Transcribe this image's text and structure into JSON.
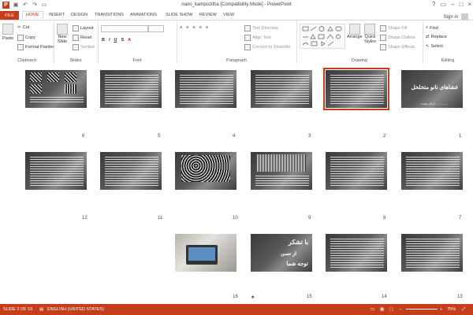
{
  "window": {
    "title": "nano_kampozitha [Compatibility Mode] - PowerPoint",
    "signin": "Sign in"
  },
  "tabs": [
    "FILE",
    "HOME",
    "INSERT",
    "DESIGN",
    "TRANSITIONS",
    "ANIMATIONS",
    "SLIDE SHOW",
    "REVIEW",
    "VIEW"
  ],
  "active_tab": "HOME",
  "ribbon": {
    "clipboard": {
      "label": "Clipboard",
      "paste": "Paste",
      "cut": "Cut",
      "copy": "Copy",
      "format_painter": "Format Painter"
    },
    "slides": {
      "label": "Slides",
      "new_slide": "New",
      "new_slide_2": "Slide",
      "layout": "Layout",
      "reset": "Reset",
      "section": "Section"
    },
    "font": {
      "label": "Font"
    },
    "paragraph": {
      "label": "Paragraph",
      "text_direction": "Text Direction",
      "align_text": "Align Text",
      "convert_smartart": "Convert to SmartArt"
    },
    "drawing": {
      "label": "Drawing",
      "arrange": "Arrange",
      "quick_styles": "Quick",
      "quick_styles_2": "Styles",
      "shape_fill": "Shape Fill",
      "shape_outline": "Shape Outline",
      "shape_effects": "Shape Effects"
    },
    "editing": {
      "label": "Editing",
      "find": "Find",
      "replace": "Replace",
      "select": "Select"
    }
  },
  "slides": [
    {
      "num": "1",
      "title": "غشاهای نانو متخلخل",
      "subtitle": "ارائه دهنده : ............"
    },
    {
      "num": "2",
      "selected": true
    },
    {
      "num": "3"
    },
    {
      "num": "4"
    },
    {
      "num": "5"
    },
    {
      "num": "6"
    },
    {
      "num": "7"
    },
    {
      "num": "8"
    },
    {
      "num": "9"
    },
    {
      "num": "10"
    },
    {
      "num": "11"
    },
    {
      "num": "12"
    },
    {
      "num": "13"
    },
    {
      "num": "14"
    },
    {
      "num": "15",
      "line1": "با تشکر",
      "line2": "از حسن",
      "line3": "توجه شما"
    },
    {
      "num": "16"
    }
  ],
  "slide15_marker": "★",
  "status": {
    "slide": "SLIDE 2 OF 16",
    "language": "ENGLISH (UNITED STATES)",
    "zoom": "75%"
  }
}
